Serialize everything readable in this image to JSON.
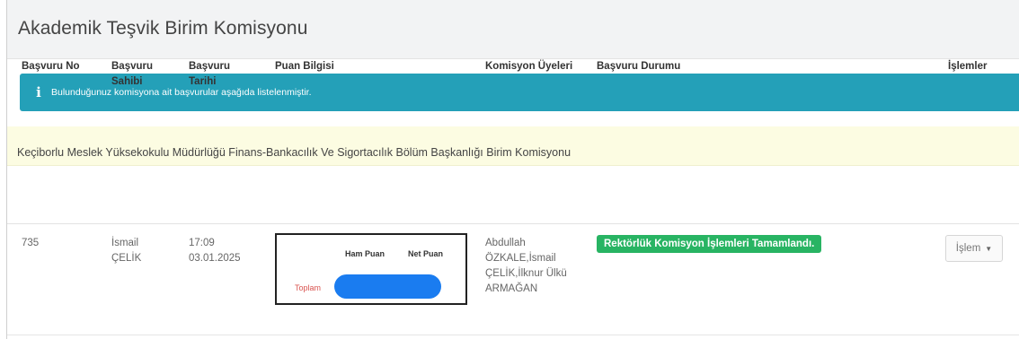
{
  "page": {
    "title": "Akademik Teşvik Birim Komisyonu"
  },
  "info": {
    "icon": "info-icon",
    "message": "Bulunduğunuz komisyona ait başvurular aşağıda listelenmiştir."
  },
  "panel": {
    "title": "Keçiborlu Meslek Yüksekokulu Müdürlüğü Finans-Bankacılık Ve Sigortacılık Bölüm Başkanlığı Birim Komisyonu"
  },
  "table": {
    "headers": {
      "no": "Başvuru No",
      "owner_1": "Başvuru",
      "owner_2": "Sahibi",
      "date_1": "Başvuru",
      "date_2": "Tarihi",
      "score": "Puan Bilgisi",
      "members": "Komisyon Üyeleri",
      "status": "Başvuru Durumu",
      "actions": "İşlemler"
    },
    "rows": [
      {
        "no": "735",
        "owner_1": "İsmail",
        "owner_2": "ÇELİK",
        "time": "17:09",
        "date": "03.01.2025",
        "score": {
          "ham": "Ham Puan",
          "net": "Net Puan",
          "total": "Toplam"
        },
        "members": [
          "Abdullah",
          "ÖZKALE,İsmail",
          "ÇELİK,İlknur Ülkü",
          "ARMAĞAN"
        ],
        "status": "Rektörlük Komisyon İşlemleri Tamamlandı.",
        "action": "İşlem",
        "action_icon": "caret-down-icon"
      }
    ]
  },
  "colors": {
    "info": "#24a0b8",
    "panel_heading": "#fcfce2",
    "status_success": "#28b463",
    "total_label": "#d9534f"
  }
}
